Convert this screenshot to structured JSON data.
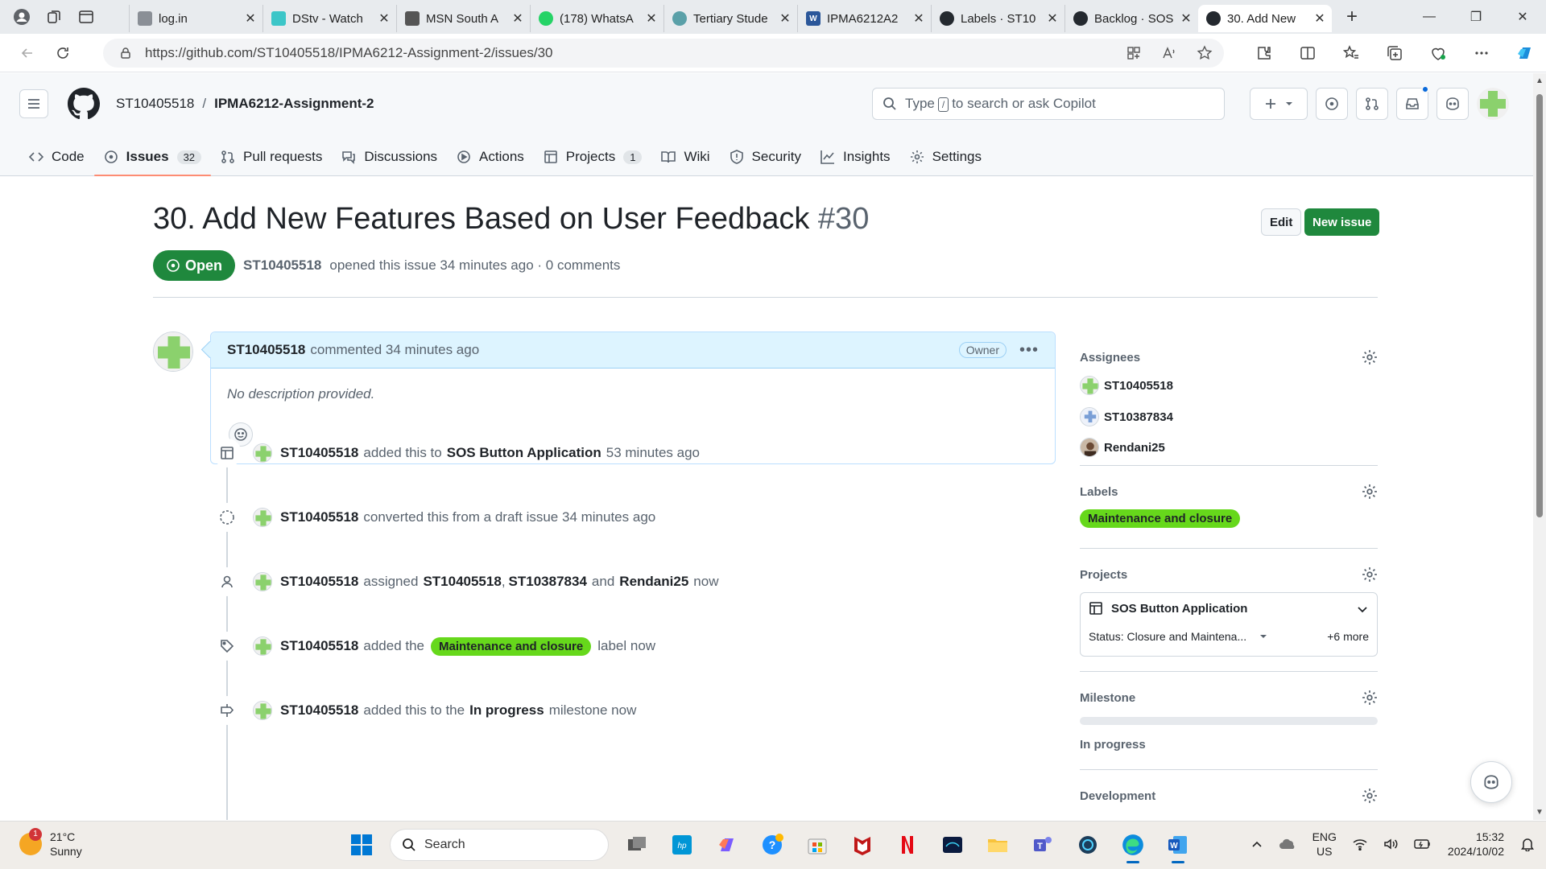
{
  "browser": {
    "tabs": [
      {
        "label": "log.in",
        "color": "#8a8f96"
      },
      {
        "label": "DStv - Watch",
        "color": "#3cc6c8"
      },
      {
        "label": "MSN South A",
        "color": "#555555"
      },
      {
        "label": "(178) WhatsA",
        "color": "#25d366"
      },
      {
        "label": "Tertiary Stude",
        "color": "#5aa0a8"
      },
      {
        "label": "IPMA6212A2",
        "color": "#2b579a"
      },
      {
        "label": "Labels · ST10",
        "color": "#24292f"
      },
      {
        "label": "Backlog · SOS",
        "color": "#24292f"
      },
      {
        "label": "30. Add New",
        "color": "#24292f"
      }
    ],
    "url": "https://github.com/ST10405518/IPMA6212-Assignment-2/issues/30"
  },
  "header": {
    "owner": "ST10405518",
    "separator": "/",
    "repo": "IPMA6212-Assignment-2",
    "search_before": "Type",
    "search_key": "/",
    "search_after": "to search or ask Copilot"
  },
  "repo_nav": [
    {
      "label": "Code",
      "icon": "code-icon"
    },
    {
      "label": "Issues",
      "icon": "issue-icon",
      "count": "32"
    },
    {
      "label": "Pull requests",
      "icon": "pull-request-icon"
    },
    {
      "label": "Discussions",
      "icon": "discussions-icon"
    },
    {
      "label": "Actions",
      "icon": "actions-icon"
    },
    {
      "label": "Projects",
      "icon": "projects-icon",
      "count": "1"
    },
    {
      "label": "Wiki",
      "icon": "book-icon"
    },
    {
      "label": "Security",
      "icon": "shield-icon"
    },
    {
      "label": "Insights",
      "icon": "graph-icon"
    },
    {
      "label": "Settings",
      "icon": "gear-icon"
    }
  ],
  "issue": {
    "title": "30. Add New Features Based on User Feedback",
    "number": "#30",
    "edit_label": "Edit",
    "new_issue_label": "New issue",
    "state": "Open",
    "author": "ST10405518",
    "opened_text": "opened this issue 34 minutes ago · 0 comments"
  },
  "comment": {
    "author": "ST10405518",
    "meta": "commented 34 minutes ago",
    "badge": "Owner",
    "body": "No description provided."
  },
  "timeline": {
    "project": {
      "actor": "ST10405518",
      "pre": "added this to",
      "target": "SOS Button Application",
      "time": "53 minutes ago"
    },
    "converted": {
      "actor": "ST10405518",
      "text": "converted this from a draft issue 34 minutes ago"
    },
    "assigned": {
      "actor": "ST10405518",
      "pre": "assigned",
      "a1": "ST10405518",
      "comma": ",",
      "a2": "ST10387834",
      "and": "and",
      "a3": "Rendani25",
      "time": "now"
    },
    "labeled": {
      "actor": "ST10405518",
      "pre": "added the",
      "label": "Maintenance and closure",
      "post": "label now"
    },
    "milestone": {
      "actor": "ST10405518",
      "pre": "added this to the",
      "target": "In progress",
      "post": "milestone now"
    }
  },
  "sidebar": {
    "assignees_title": "Assignees",
    "assignees": [
      "ST10405518",
      "ST10387834",
      "Rendani25"
    ],
    "labels_title": "Labels",
    "label": "Maintenance and closure",
    "label_color": "#66d81b",
    "projects_title": "Projects",
    "project_name": "SOS Button Application",
    "project_status": "Status: Closure and Maintena...",
    "project_more": "+6 more",
    "milestone_title": "Milestone",
    "milestone_name": "In progress",
    "development_title": "Development"
  },
  "taskbar": {
    "temp": "21°C",
    "condition": "Sunny",
    "weather_badge": "1",
    "search": "Search",
    "lang1": "ENG",
    "lang2": "US",
    "time": "15:32",
    "date": "2024/10/02"
  }
}
